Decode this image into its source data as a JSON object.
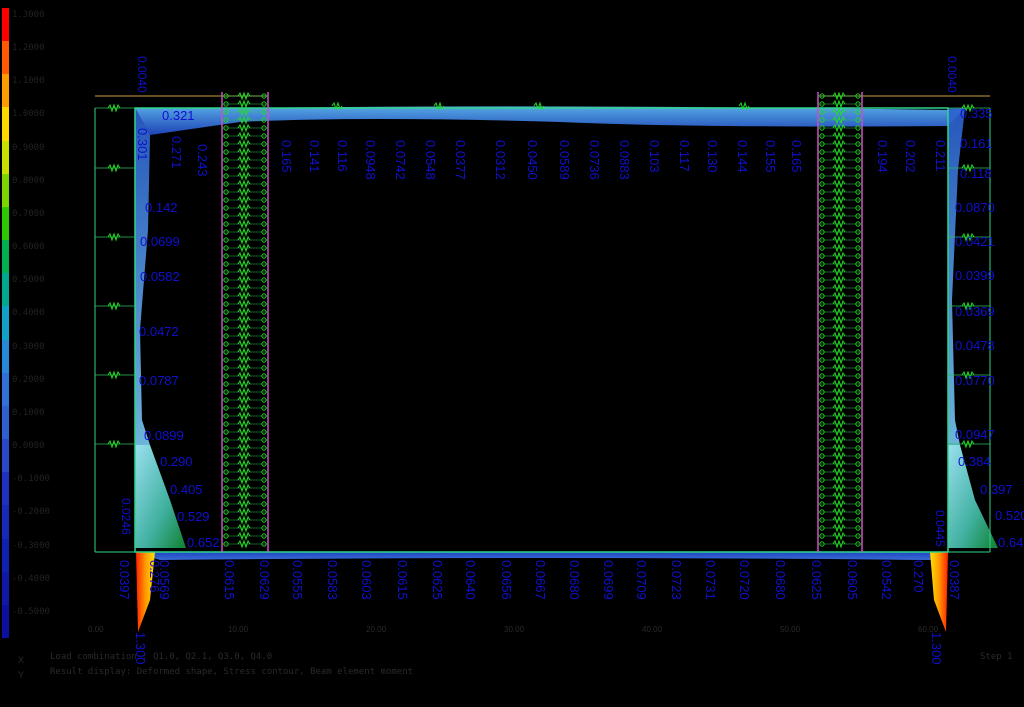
{
  "colors": {
    "background": "#000000",
    "frame": "#2fd58a",
    "spring": "#22dd22",
    "label": "#1010d0",
    "support_line": "#d14cc8",
    "fill_light": "#5aa6e8",
    "fill_dark": "#1e3fb0",
    "hot": "#ff2a00"
  },
  "legend": {
    "labels": [
      "1.3000",
      "1.2000",
      "1.1000",
      "1.0000",
      "0.9000",
      "0.8000",
      "0.7000",
      "0.6000",
      "0.5000",
      "0.4000",
      "0.3000",
      "0.2000",
      "0.1000",
      "0.0000",
      "-0.1000",
      "-0.2000",
      "-0.3000",
      "-0.4000",
      "-0.5000"
    ],
    "gradient": [
      "#ff0000",
      "#ff5a00",
      "#ff9a00",
      "#ffd800",
      "#c8e000",
      "#7cd400",
      "#2ec800",
      "#00b050",
      "#00a890",
      "#10a0c8",
      "#2888d8",
      "#3070d8",
      "#3060d0",
      "#2a48c8",
      "#2030c0",
      "#1828b8",
      "#1020b0",
      "#1018a8",
      "#0c10a0"
    ]
  },
  "top_labels": [
    "0.165",
    "0.141",
    "0.116",
    "0.0948",
    "0.0742",
    "0.0548",
    "0.0377",
    "0.0312",
    "0.0450",
    "0.0589",
    "0.0736",
    "0.0883",
    "0.103",
    "0.117",
    "0.130",
    "0.144",
    "0.155",
    "0.165",
    "0.194",
    "0.202",
    "0.211"
  ],
  "top_labels_left": [
    "0.301",
    "0.271",
    "0.243"
  ],
  "top_beam_label": "0.321",
  "left_wall_labels": [
    "0.142",
    "0.0699",
    "0.0582",
    "0.0472",
    "0.0787",
    "0.0899",
    "0.290",
    "0.405",
    "0.529",
    "0.652"
  ],
  "left_wall_low": "0.0246",
  "right_wall_labels": [
    "0.335",
    "0.161",
    "0.118",
    "0.0870",
    "0.0421",
    "0.0399",
    "0.0369",
    "0.0478",
    "0.0770",
    "0.0947",
    "0.384",
    "0.397",
    "0.520",
    "0.64"
  ],
  "right_wall_low": "0.0445",
  "bottom_labels": [
    "0.0397",
    "0.276",
    "0.0569",
    "0.0615",
    "0.0629",
    "0.0555",
    "0.0583",
    "0.0603",
    "0.0615",
    "0.0625",
    "0.0640",
    "0.0656",
    "0.0667",
    "0.0680",
    "0.0699",
    "0.0709",
    "0.0723",
    "0.0731",
    "0.0720",
    "0.0680",
    "0.0625",
    "0.0605",
    "0.0542",
    "0.270",
    "0.0387"
  ],
  "corner_values": [
    "1.300",
    "1.300"
  ],
  "axis_ticks": [
    "0.00",
    "10.00",
    "20.00",
    "30.00",
    "40.00",
    "50.00",
    "60.00"
  ],
  "footer": {
    "line1": "Load combination : Q1.0,  Q2.1,  Q3.0,  Q4.0",
    "line2": "Result display: Deformed shape, Stress contour, Beam element moment",
    "right": "Step 1",
    "marks": "X\nY"
  }
}
